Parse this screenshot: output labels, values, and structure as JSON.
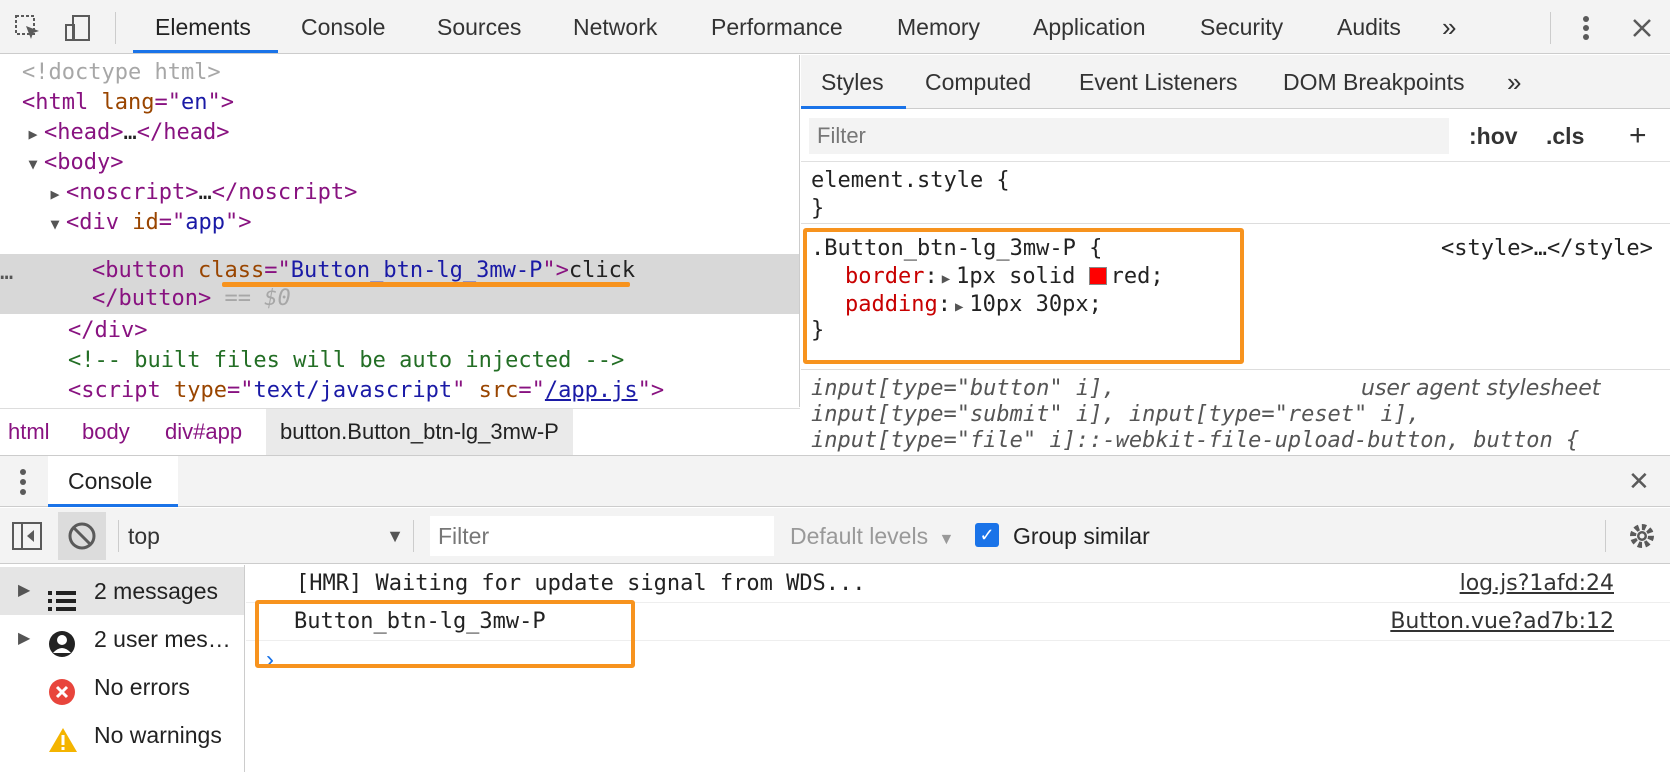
{
  "topbar": {
    "tabs": [
      {
        "label": "Elements"
      },
      {
        "label": "Console"
      },
      {
        "label": "Sources"
      },
      {
        "label": "Network"
      },
      {
        "label": "Performance"
      },
      {
        "label": "Memory"
      },
      {
        "label": "Application"
      },
      {
        "label": "Security"
      },
      {
        "label": "Audits"
      }
    ],
    "more": "»",
    "active_tab": "Elements",
    "accent_color": "#1a73e8"
  },
  "dom": {
    "doctype": "<!doctype html>",
    "html_open": {
      "tag": "<html",
      "attr": "lang",
      "eq": "=\"",
      "val": "en",
      "end": "\">"
    },
    "head": {
      "open": "<head>",
      "ellipsis": "…",
      "close": "</head>"
    },
    "body_open": "<body>",
    "noscript": {
      "open": "<noscript>",
      "ellipsis": "…",
      "close": "</noscript>"
    },
    "div_open": {
      "tag": "<div",
      "attr": "id",
      "eq": "=\"",
      "val": "app",
      "end": "\">"
    },
    "button": {
      "tag": "<button",
      "attr": "class",
      "eq": "=\"",
      "val": "Button_btn-lg_3mw-P",
      "end": "\">",
      "text": "click"
    },
    "button_close": "</button>",
    "eq0": "== $0",
    "div_close": "</div>",
    "comment": "<!-- built files will be auto injected -->",
    "script": {
      "tag": "<script",
      "attr1": "type",
      "val1": "text/javascript",
      "attr2": "src",
      "val2": "/app.js",
      "end": "\">"
    },
    "row_dots": "…"
  },
  "breadcrumb": [
    "html",
    "body",
    "div#app",
    "button.Button_btn-lg_3mw-P"
  ],
  "styles": {
    "tabs": [
      {
        "label": "Styles"
      },
      {
        "label": "Computed"
      },
      {
        "label": "Event Listeners"
      },
      {
        "label": "DOM Breakpoints"
      }
    ],
    "more": "»",
    "filter_placeholder": "Filter",
    "hov": ":hov",
    "cls": ".cls",
    "plus": "+",
    "element_style": "element.style {",
    "close_brace": "}",
    "rule": {
      "selector": ".Button_btn-lg_3mw-P {",
      "source": "<style>…</style>",
      "decls": [
        {
          "prop": "border",
          "value": "1px solid",
          "color_value": "red;",
          "swatch_color": "#ff0000"
        },
        {
          "prop": "padding",
          "value": "10px 30px;"
        }
      ]
    },
    "ua": {
      "line1": "input[type=\"button\" i],",
      "source": "user agent stylesheet",
      "line2": "input[type=\"submit\" i], input[type=\"reset\" i],",
      "line3": "input[type=\"file\" i]::-webkit-file-upload-button, button {"
    },
    "highlight_color": "#f7931e"
  },
  "drawer": {
    "title": "Console",
    "close": "✕"
  },
  "console_toolbar": {
    "context": "top",
    "filter_placeholder": "Filter",
    "levels": "Default levels",
    "group_similar": "Group similar",
    "group_similar_checked": true
  },
  "console_sidebar": [
    {
      "label": "2 messages",
      "icon": "list-icon"
    },
    {
      "label": "2 user mes…",
      "icon": "user-icon"
    },
    {
      "label": "No errors",
      "icon": "error-icon"
    },
    {
      "label": "No warnings",
      "icon": "warning-icon"
    }
  ],
  "console_messages": [
    {
      "text": "[HMR] Waiting for update signal from WDS...",
      "source": "log.js?1afd:24"
    },
    {
      "text": "Button_btn-lg_3mw-P",
      "source": "Button.vue?ad7b:12"
    }
  ],
  "prompt": "›"
}
